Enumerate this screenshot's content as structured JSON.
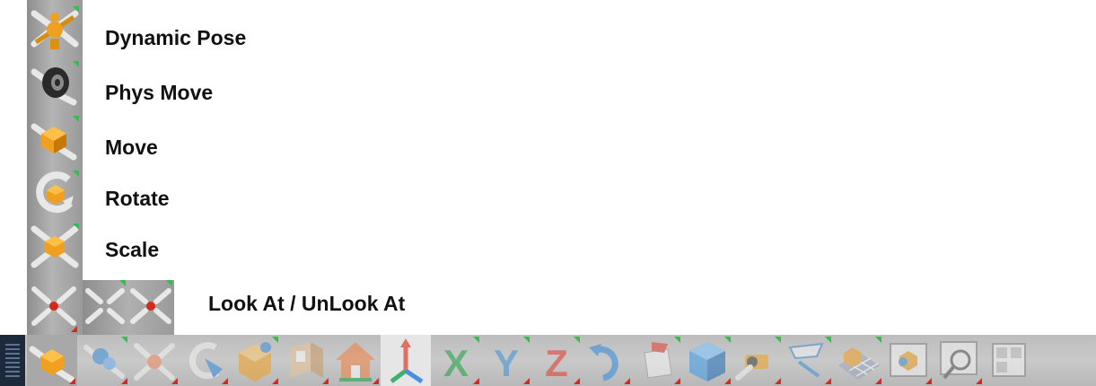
{
  "tools": [
    {
      "label": "Dynamic Pose",
      "icon": "dynamic-pose-icon"
    },
    {
      "label": "Phys Move",
      "icon": "phys-move-icon"
    },
    {
      "label": "Move",
      "icon": "move-icon"
    },
    {
      "label": "Rotate",
      "icon": "rotate-icon"
    },
    {
      "label": "Scale",
      "icon": "scale-icon"
    },
    {
      "label": "Look At / UnLook At",
      "icon": "look-at-icon"
    }
  ],
  "toolbar": {
    "buttons": [
      {
        "icon": "move-icon",
        "state": "active"
      },
      {
        "icon": "phys-move-icon",
        "state": "dim"
      },
      {
        "icon": "dynamic-pose-icon",
        "state": "dim"
      },
      {
        "icon": "rotate-camera-icon",
        "state": "dim"
      },
      {
        "icon": "box-icon",
        "state": "dim"
      },
      {
        "icon": "room-icon",
        "state": "dim"
      },
      {
        "icon": "home-icon",
        "state": "dim"
      },
      {
        "icon": "axes-icon",
        "state": "selected"
      },
      {
        "icon": "x-axis-icon",
        "label": "X",
        "state": "dim"
      },
      {
        "icon": "y-axis-icon",
        "label": "Y",
        "state": "dim"
      },
      {
        "icon": "z-axis-icon",
        "label": "Z",
        "state": "dim"
      },
      {
        "icon": "undo-rotate-icon",
        "state": "dim"
      },
      {
        "icon": "flag-icon",
        "state": "dim"
      },
      {
        "icon": "cube-icon",
        "state": "dim"
      },
      {
        "icon": "camera-icon",
        "state": "dim"
      },
      {
        "icon": "light-icon",
        "state": "dim"
      },
      {
        "icon": "grid-icon",
        "state": "dim"
      },
      {
        "icon": "screen-icon",
        "state": "dim"
      },
      {
        "icon": "magnify-icon",
        "state": "dim"
      },
      {
        "icon": "panel-icon",
        "state": "dim"
      }
    ]
  },
  "colors": {
    "orange": "#f0a020",
    "green_marker": "#2cc24a",
    "red_marker": "#e0231f",
    "grip": "#1d2a3c"
  }
}
